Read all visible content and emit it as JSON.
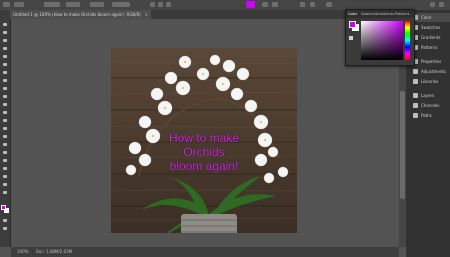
{
  "colors": {
    "foreground": "#cc00ff",
    "text_color": "#cc2bd8",
    "background": "#ffffff"
  },
  "document": {
    "tab_title": "Untitled-1 @ 100% (How to make Orchids bloom again!, RGB/8)",
    "close_glyph": "×",
    "overlay_lines": [
      "How to make",
      "Orchids",
      "bloom again!"
    ]
  },
  "status": {
    "zoom": "100%",
    "doc_info": "Doc: 1.68M/2.03M"
  },
  "color_panel": {
    "tabs": [
      "Color",
      "Swatches",
      "Gradients",
      "Patterns"
    ]
  },
  "right_panels": {
    "items": [
      {
        "label": "Color",
        "icon": "color-wheel-icon"
      },
      {
        "label": "Swatches",
        "icon": "grid-icon"
      },
      {
        "label": "Gradients",
        "icon": "gradient-icon"
      },
      {
        "label": "Patterns",
        "icon": "pattern-icon"
      },
      {
        "label": "Properties",
        "icon": "sliders-icon"
      },
      {
        "label": "Adjustments",
        "icon": "adjust-icon"
      },
      {
        "label": "Libraries",
        "icon": "library-icon"
      },
      {
        "label": "Layers",
        "icon": "layers-icon"
      },
      {
        "label": "Channels",
        "icon": "channels-icon"
      },
      {
        "label": "Paths",
        "icon": "paths-icon"
      }
    ]
  }
}
